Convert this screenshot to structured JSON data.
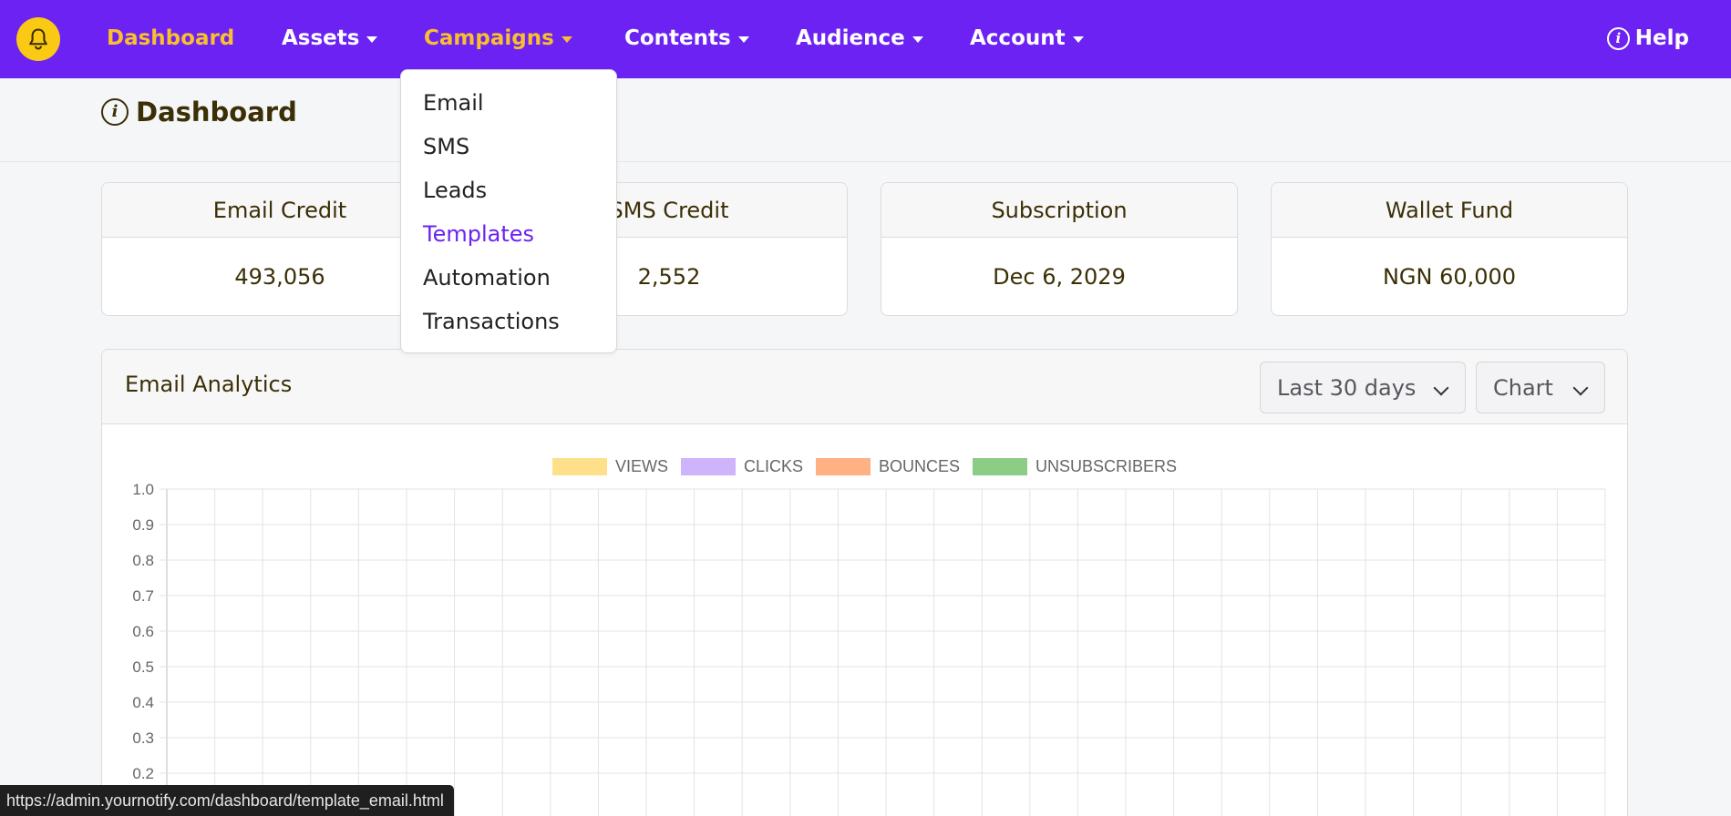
{
  "colors": {
    "navbar_bg": "#6c22f2",
    "nav_active": "#f9bf2d",
    "bell_bg": "#f9c914",
    "dropdown_active": "#6c22f2",
    "text_dark": "#3b2f06"
  },
  "navbar": {
    "bell_icon": "bell-icon",
    "items": [
      {
        "label": "Dashboard",
        "active": true,
        "has_caret": false
      },
      {
        "label": "Assets",
        "active": false,
        "has_caret": true
      },
      {
        "label": "Campaigns",
        "active": true,
        "has_caret": true
      },
      {
        "label": "Contents",
        "active": false,
        "has_caret": true
      },
      {
        "label": "Audience",
        "active": false,
        "has_caret": true
      },
      {
        "label": "Account",
        "active": false,
        "has_caret": true
      }
    ],
    "help_label": "Help",
    "help_icon": "info-icon"
  },
  "campaigns_menu": {
    "items": [
      {
        "label": "Email",
        "active": false
      },
      {
        "label": "SMS",
        "active": false
      },
      {
        "label": "Leads",
        "active": false
      },
      {
        "label": "Templates",
        "active": true
      },
      {
        "label": "Automation",
        "active": false
      },
      {
        "label": "Transactions",
        "active": false
      }
    ]
  },
  "page": {
    "title": "Dashboard",
    "title_icon": "info-icon"
  },
  "cards": [
    {
      "title": "Email Credit",
      "value": "493,056"
    },
    {
      "title": "SMS Credit",
      "value": "2,552"
    },
    {
      "title": "Subscription",
      "value": "Dec 6, 2029"
    },
    {
      "title": "Wallet Fund",
      "value": "NGN 60,000"
    }
  ],
  "analytics": {
    "title": "Email Analytics",
    "range_select": {
      "value": "Last 30 days"
    },
    "view_select": {
      "value": "Chart"
    }
  },
  "chart_data": {
    "type": "line",
    "title": "",
    "xlabel": "",
    "ylabel": "",
    "series": [
      {
        "name": "VIEWS",
        "color": "#ffe08a",
        "values": []
      },
      {
        "name": "CLICKS",
        "color": "#cdb4fb",
        "values": []
      },
      {
        "name": "BOUNCES",
        "color": "#ffb184",
        "values": []
      },
      {
        "name": "UNSUBSCRIBERS",
        "color": "#8ccc84",
        "values": []
      }
    ],
    "y_ticks": [
      "1.0",
      "0.9",
      "0.8",
      "0.7",
      "0.6",
      "0.5",
      "0.4",
      "0.3",
      "0.2"
    ],
    "ylim": [
      0,
      1.0
    ],
    "grid": true,
    "legend_position": "top-center"
  },
  "statusbar": {
    "url": "https://admin.yournotify.com/dashboard/template_email.html"
  }
}
